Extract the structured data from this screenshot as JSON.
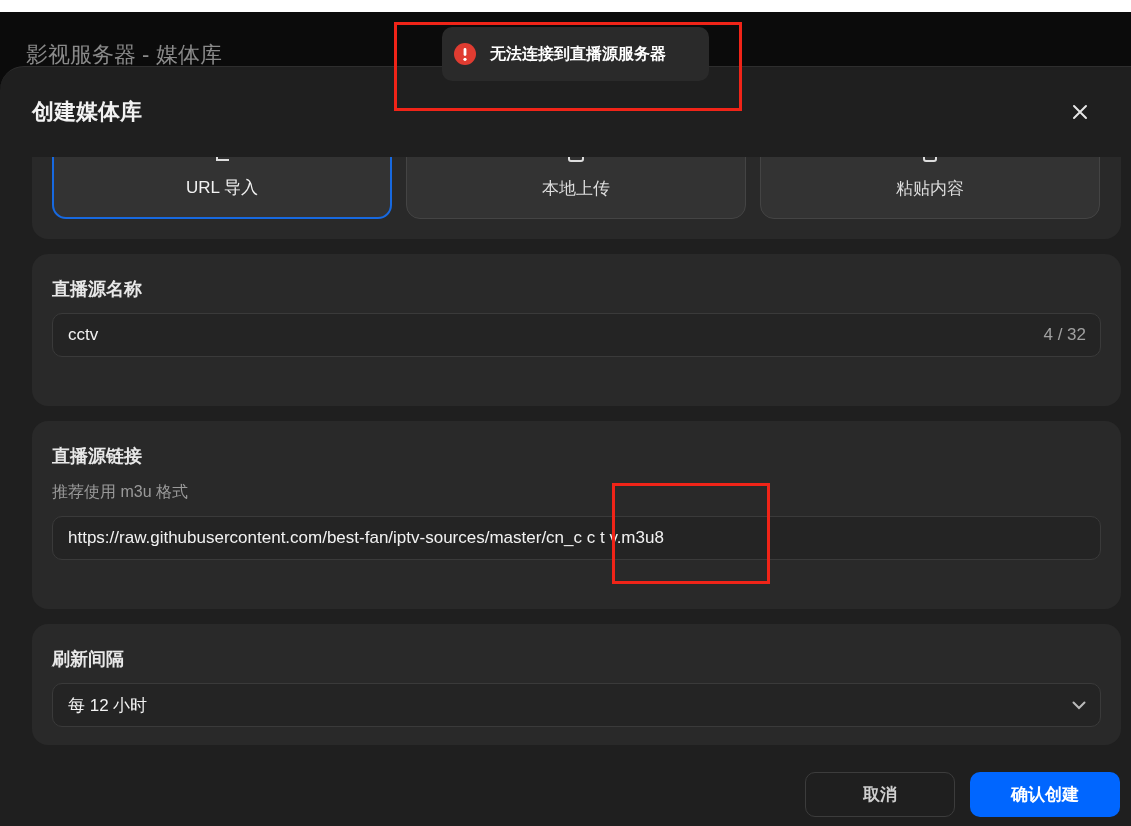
{
  "background_title": "影视服务器 - 媒体库",
  "toast": {
    "kind": "error",
    "message": "无法连接到直播源服务器"
  },
  "dialog": {
    "title": "创建媒体库",
    "source_types": [
      {
        "label": "URL 导入",
        "selected": true
      },
      {
        "label": "本地上传",
        "selected": false
      },
      {
        "label": "粘贴内容",
        "selected": false
      }
    ],
    "sections": [
      {
        "kind": "text",
        "label": "直播源名称",
        "value": "cctv",
        "counter": "4 / 32"
      },
      {
        "kind": "text",
        "label": "直播源链接",
        "hint": "推荐使用 m3u 格式",
        "value": "https://raw.githubusercontent.com/best-fan/iptv-sources/master/cn_c c t v.m3u8"
      },
      {
        "kind": "select",
        "label": "刷新间隔",
        "value": "每 12 小时"
      }
    ],
    "buttons": [
      {
        "label": "取消",
        "kind": "secondary"
      },
      {
        "label": "确认创建",
        "kind": "primary"
      }
    ]
  }
}
